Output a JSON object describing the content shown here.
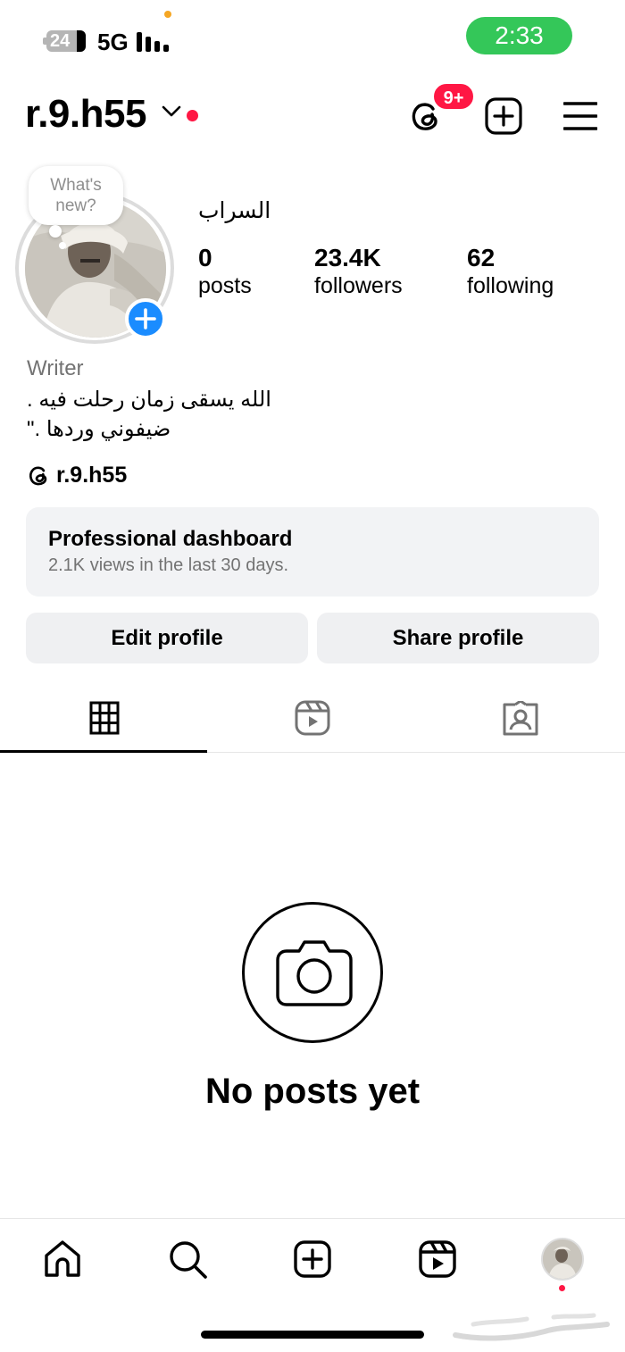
{
  "status_bar": {
    "battery": "24",
    "network": "5G",
    "time": "2:33"
  },
  "header": {
    "username": "r.9.h55",
    "notification_badge": "9+",
    "icons": [
      "threads-icon",
      "create-icon",
      "menu-icon"
    ]
  },
  "profile": {
    "note": "What's new?",
    "display_name": "السراب",
    "stats": [
      {
        "value": "0",
        "label": "posts"
      },
      {
        "value": "23.4K",
        "label": "followers"
      },
      {
        "value": "62",
        "label": "following"
      }
    ],
    "category": "Writer",
    "bio_lines": [
      "الله يسقى زمان رحلت فيه .",
      "ضيفوني وردها .\""
    ],
    "threads_handle": "r.9.h55"
  },
  "dashboard": {
    "title": "Professional dashboard",
    "subtitle": "2.1K views in the last 30 days."
  },
  "actions": {
    "edit": "Edit profile",
    "share": "Share profile"
  },
  "tabs": [
    "grid-icon",
    "reels-icon",
    "tagged-icon"
  ],
  "empty_state": {
    "title": "No posts yet"
  },
  "bottom_nav": [
    "home-icon",
    "search-icon",
    "create-icon",
    "reels-icon",
    "profile-avatar"
  ],
  "colors": {
    "accent_blue": "#1a8cff",
    "notification_red": "#ff1744",
    "clock_green": "#34c759"
  }
}
